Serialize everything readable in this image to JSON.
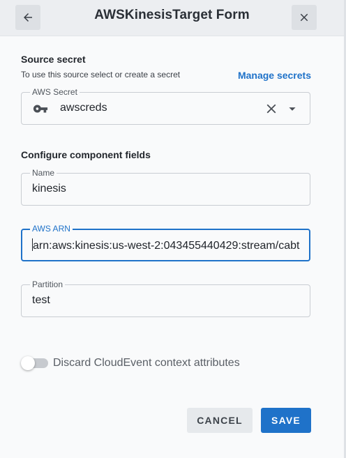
{
  "header": {
    "title": "AWSKinesisTarget Form",
    "back_icon": "arrow-left-icon",
    "close_icon": "close-icon"
  },
  "source_secret": {
    "title": "Source secret",
    "hint": "To use this source select or create a secret",
    "manage_link": "Manage secrets",
    "field_label": "AWS Secret",
    "value": "awscreds",
    "key_icon": "key-icon",
    "clear_icon": "clear-icon",
    "dropdown_icon": "caret-down-icon"
  },
  "component_fields": {
    "title": "Configure component fields",
    "name": {
      "label": "Name",
      "value": "kinesis"
    },
    "arn": {
      "label": "AWS ARN",
      "value": "arn:aws:kinesis:us-west-2:043455440429:stream/cabt"
    },
    "partition": {
      "label": "Partition",
      "value": "test"
    }
  },
  "toggle": {
    "label": "Discard CloudEvent context attributes",
    "enabled": false
  },
  "actions": {
    "cancel": "CANCEL",
    "save": "SAVE"
  },
  "colors": {
    "accent": "#1f72c9",
    "header_bg": "#eceef1",
    "page_bg": "#f9fafb"
  }
}
